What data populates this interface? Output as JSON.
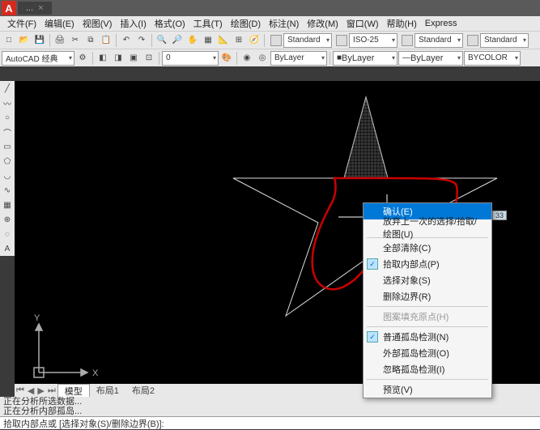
{
  "app": {
    "logo_text": "A"
  },
  "title_tabs": [
    {
      "label": "..."
    }
  ],
  "menu": [
    "文件(F)",
    "编辑(E)",
    "视图(V)",
    "插入(I)",
    "格式(O)",
    "工具(T)",
    "绘图(D)",
    "标注(N)",
    "修改(M)",
    "窗口(W)",
    "帮助(H)",
    "Express"
  ],
  "workspace": {
    "name": "AutoCAD 经典"
  },
  "styles": {
    "text": "Standard",
    "dim": "ISO-25",
    "table": "Standard",
    "mleader": "Standard"
  },
  "layers": {
    "layer": "ByLayer",
    "linetype": "ByLayer",
    "color": "BYCOLOR",
    "layerstate": "ByLayer"
  },
  "context_menu": [
    {
      "label": "确认(E)",
      "highlighted": true
    },
    {
      "label": "放弃上一次的选择/拾取/绘图(U)"
    },
    {
      "sep": true
    },
    {
      "label": "全部清除(C)"
    },
    {
      "label": "拾取内部点(P)",
      "checked": true
    },
    {
      "label": "选择对象(S)"
    },
    {
      "label": "删除边界(R)"
    },
    {
      "sep": true
    },
    {
      "label": "图案填充原点(H)",
      "disabled": true
    },
    {
      "sep": true
    },
    {
      "label": "普通孤岛检测(N)",
      "checked": true
    },
    {
      "label": "外部孤岛检测(O)"
    },
    {
      "label": "忽略孤岛检测(I)"
    },
    {
      "sep": true
    },
    {
      "label": "预览(V)"
    }
  ],
  "ucs": {
    "x": "X",
    "y": "Y"
  },
  "bottom_tabs": {
    "model": "模型",
    "layout1": "布局1",
    "layout2": "布局2"
  },
  "status": {
    "line1": "正在分析所选数据...",
    "line2": "正在分析内部孤岛..."
  },
  "cmd": {
    "text": "拾取内部点或 [选择对象(S)/删除边界(B)]:"
  },
  "dim_value": "33",
  "icons": {
    "new": "□",
    "open": "📂",
    "save": "💾",
    "print": "🖨",
    "undo": "↶",
    "redo": "↷",
    "cut": "✂",
    "copy": "⧉",
    "paste": "📋",
    "find": "🔍",
    "pan": "✋",
    "zoom": "🔎",
    "line": "╱",
    "circle": "○",
    "arc": "⌒",
    "rect": "▭",
    "polyline": "〰",
    "text": "A",
    "hatch": "▦",
    "dim": "⟷",
    "move": "✥",
    "rotate": "⟳",
    "scale": "⤢",
    "erase": "✕",
    "0": "0"
  }
}
